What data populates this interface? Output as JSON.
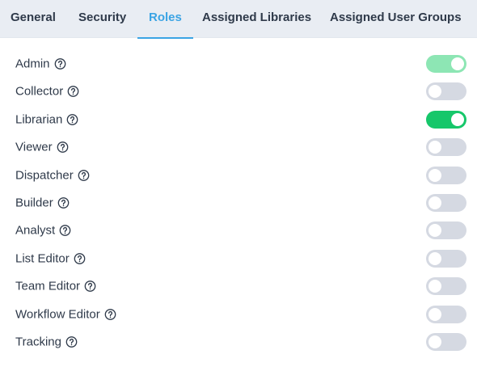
{
  "tabs": [
    {
      "label": "General",
      "active": false
    },
    {
      "label": "Security",
      "active": false
    },
    {
      "label": "Roles",
      "active": true
    },
    {
      "label": "Assigned Libraries",
      "active": false
    },
    {
      "label": "Assigned User Groups",
      "active": false
    }
  ],
  "roles": [
    {
      "label": "Admin",
      "enabled": true,
      "disabled_state": true
    },
    {
      "label": "Collector",
      "enabled": false
    },
    {
      "label": "Librarian",
      "enabled": true
    },
    {
      "label": "Viewer",
      "enabled": false
    },
    {
      "label": "Dispatcher",
      "enabled": false
    },
    {
      "label": "Builder",
      "enabled": false
    },
    {
      "label": "Analyst",
      "enabled": false
    },
    {
      "label": "List Editor",
      "enabled": false
    },
    {
      "label": "Team Editor",
      "enabled": false
    },
    {
      "label": "Workflow Editor",
      "enabled": false
    },
    {
      "label": "Tracking",
      "enabled": false
    }
  ],
  "colors": {
    "accent": "#3ba4e4",
    "toggle_on": "#16c76a",
    "toggle_on_disabled": "#8de6b4",
    "toggle_off": "#d5d9e2",
    "tab_bar": "#e9edf3"
  },
  "icons": {
    "help": "question-circle-icon"
  }
}
